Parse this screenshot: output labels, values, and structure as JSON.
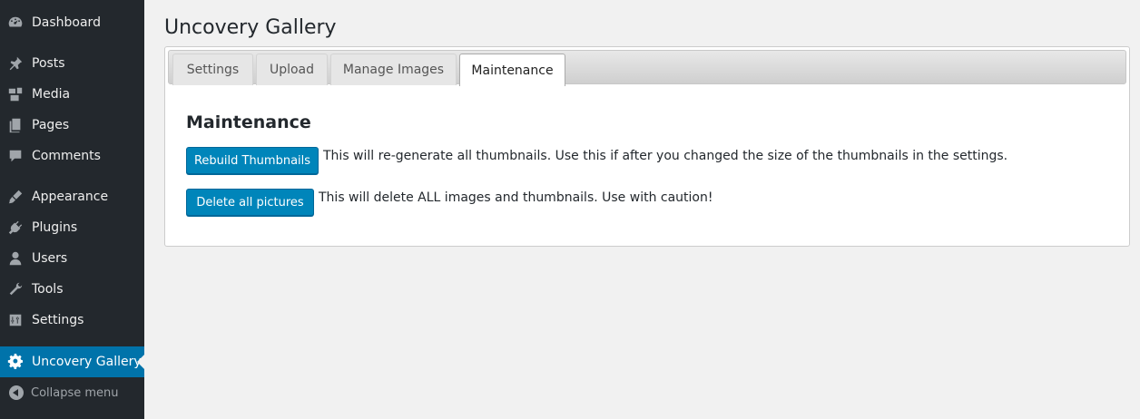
{
  "sidebar": {
    "items": [
      {
        "label": "Dashboard",
        "icon": "dashboard-icon"
      },
      {
        "label": "Posts",
        "icon": "pin-icon"
      },
      {
        "label": "Media",
        "icon": "media-icon"
      },
      {
        "label": "Pages",
        "icon": "pages-icon"
      },
      {
        "label": "Comments",
        "icon": "comment-bubble-icon"
      },
      {
        "label": "Appearance",
        "icon": "paintbrush-icon"
      },
      {
        "label": "Plugins",
        "icon": "plug-icon"
      },
      {
        "label": "Users",
        "icon": "user-icon"
      },
      {
        "label": "Tools",
        "icon": "wrench-icon"
      },
      {
        "label": "Settings",
        "icon": "sliders-icon"
      },
      {
        "label": "Uncovery Gallery",
        "icon": "gear-icon",
        "current": true
      }
    ],
    "collapse_label": "Collapse menu"
  },
  "page": {
    "title": "Uncovery Gallery"
  },
  "tabs": [
    {
      "label": "Settings"
    },
    {
      "label": "Upload"
    },
    {
      "label": "Manage Images"
    },
    {
      "label": "Maintenance",
      "active": true
    }
  ],
  "maintenance": {
    "heading": "Maintenance",
    "rebuild": {
      "button_label": "Rebuild Thumbnails",
      "description": "This will re-generate all thumbnails. Use this if after you changed the size of the thumbnails in the settings."
    },
    "delete": {
      "button_label": "Delete all pictures",
      "description": "This will delete ALL images and thumbnails. Use with caution!"
    }
  },
  "colors": {
    "sidebar_bg": "#23282d",
    "current_item_bg": "#0073aa",
    "button_bg": "#0085ba"
  }
}
